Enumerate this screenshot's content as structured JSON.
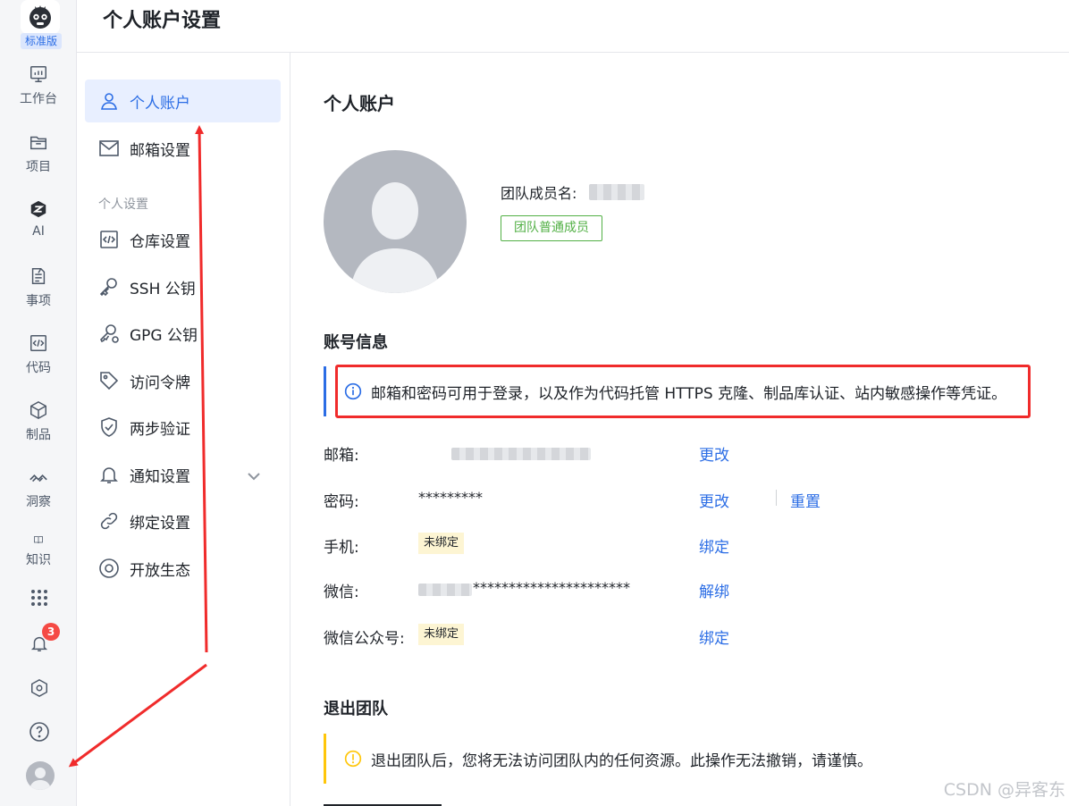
{
  "rail": {
    "edition": "标准版",
    "items": [
      {
        "label": "工作台",
        "icon": "dashboard-icon"
      },
      {
        "label": "项目",
        "icon": "folder-icon"
      },
      {
        "label": "AI",
        "icon": "ai-icon"
      },
      {
        "label": "事项",
        "icon": "issue-icon"
      },
      {
        "label": "代码",
        "icon": "code-icon"
      },
      {
        "label": "制品",
        "icon": "package-icon"
      },
      {
        "label": "洞察",
        "icon": "insight-icon"
      },
      {
        "label": "知识",
        "icon": "book-icon"
      }
    ],
    "notification_count": "3"
  },
  "header": {
    "title": "个人账户设置"
  },
  "sidebar": {
    "items": [
      {
        "label": "个人账户",
        "icon": "user-icon"
      },
      {
        "label": "邮箱设置",
        "icon": "mail-icon"
      },
      {
        "label": "仓库设置",
        "icon": "code-icon"
      },
      {
        "label": "SSH 公钥",
        "icon": "key-icon"
      },
      {
        "label": "GPG 公钥",
        "icon": "gpg-key-icon"
      },
      {
        "label": "访问令牌",
        "icon": "tag-icon"
      },
      {
        "label": "两步验证",
        "icon": "shield-check-icon"
      },
      {
        "label": "通知设置",
        "icon": "bell-icon"
      },
      {
        "label": "绑定设置",
        "icon": "link-icon"
      },
      {
        "label": "开放生态",
        "icon": "ecosystem-icon"
      }
    ],
    "group_label": "个人设置"
  },
  "main": {
    "title": "个人账户",
    "member_label": "团队成员名:",
    "role": "团队普通成员",
    "account_section": "账号信息",
    "info_notice": "邮箱和密码可用于登录，以及作为代码托管 HTTPS 克隆、制品库认证、站内敏感操作等凭证。",
    "rows": {
      "email": {
        "label": "邮箱:",
        "action": "更改"
      },
      "password": {
        "label": "密码:",
        "value": "*********",
        "action": "更改",
        "action2": "重置"
      },
      "phone": {
        "label": "手机:",
        "tag": "未绑定",
        "action": "绑定"
      },
      "wechat": {
        "label": "微信:",
        "value": "**********************",
        "action": "解绑"
      },
      "wechat_mp": {
        "label": "微信公众号:",
        "tag": "未绑定",
        "action": "绑定"
      }
    },
    "leave_section": "退出团队",
    "leave_notice": "退出团队后，您将无法访问团队内的任何资源。此操作无法撤销，请谨慎。"
  },
  "watermark": "CSDN @异客东",
  "colors": {
    "accent": "#2b6de5",
    "success": "#52b045",
    "warning": "#ffc60a",
    "annotation": "#f02b2b"
  }
}
